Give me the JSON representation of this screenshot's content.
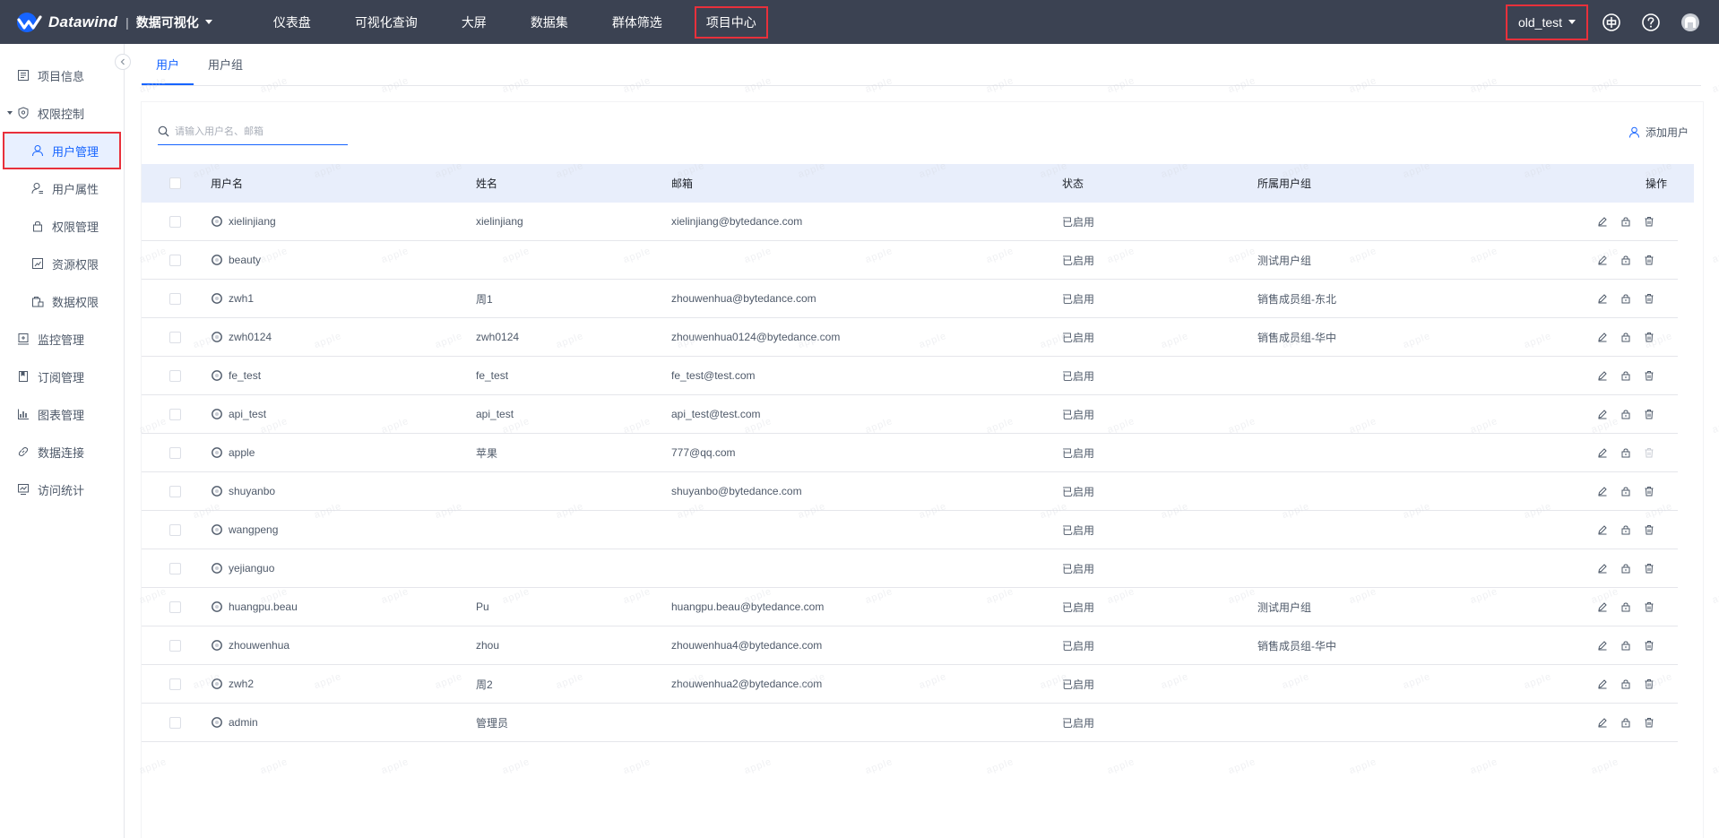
{
  "header": {
    "brand": "Datawind",
    "product": "数据可视化",
    "nav": [
      "仪表盘",
      "可视化查询",
      "大屏",
      "数据集",
      "群体筛选",
      "项目中心"
    ],
    "active_nav": "项目中心",
    "project": "old_test",
    "icons": [
      "plus-circle-icon",
      "help-icon",
      "avatar-icon"
    ]
  },
  "sidebar": {
    "items": [
      {
        "label": "项目信息",
        "icon": "info-icon"
      },
      {
        "label": "权限控制",
        "icon": "shield-icon"
      },
      {
        "label": "用户管理",
        "icon": "user-icon"
      },
      {
        "label": "用户属性",
        "icon": "user-attr-icon"
      },
      {
        "label": "权限管理",
        "icon": "lock-icon"
      },
      {
        "label": "资源权限",
        "icon": "resource-icon"
      },
      {
        "label": "数据权限",
        "icon": "data-lock-icon"
      },
      {
        "label": "监控管理",
        "icon": "monitor-icon"
      },
      {
        "label": "订阅管理",
        "icon": "bookmark-icon"
      },
      {
        "label": "图表管理",
        "icon": "chart-icon"
      },
      {
        "label": "数据连接",
        "icon": "link-icon"
      },
      {
        "label": "访问统计",
        "icon": "stats-icon"
      }
    ]
  },
  "tabs": [
    "用户",
    "用户组"
  ],
  "search": {
    "placeholder": "请输入用户名、邮箱"
  },
  "add_user": "添加用户",
  "table": {
    "columns": [
      "用户名",
      "姓名",
      "邮箱",
      "状态",
      "所属用户组",
      "操作"
    ],
    "rows": [
      {
        "user": "xielinjiang",
        "name": "xielinjiang",
        "email": "xielinjiang@bytedance.com",
        "status": "已启用",
        "group": ""
      },
      {
        "user": "beauty",
        "name": "",
        "email": "",
        "status": "已启用",
        "group": "测试用户组"
      },
      {
        "user": "zwh1",
        "name": "周1",
        "email": "zhouwenhua@bytedance.com",
        "status": "已启用",
        "group": "销售成员组-东北"
      },
      {
        "user": "zwh0124",
        "name": "zwh0124",
        "email": "zhouwenhua0124@bytedance.com",
        "status": "已启用",
        "group": "销售成员组-华中"
      },
      {
        "user": "fe_test",
        "name": "fe_test",
        "email": "fe_test@test.com",
        "status": "已启用",
        "group": ""
      },
      {
        "user": "api_test",
        "name": "api_test",
        "email": "api_test@test.com",
        "status": "已启用",
        "group": ""
      },
      {
        "user": "apple",
        "name": "苹果",
        "email": "777@qq.com",
        "status": "已启用",
        "group": ""
      },
      {
        "user": "shuyanbo",
        "name": "",
        "email": "shuyanbo@bytedance.com",
        "status": "已启用",
        "group": ""
      },
      {
        "user": "wangpeng",
        "name": "",
        "email": "",
        "status": "已启用",
        "group": ""
      },
      {
        "user": "yejianguo",
        "name": "",
        "email": "",
        "status": "已启用",
        "group": ""
      },
      {
        "user": "huangpu.beau",
        "name": "Pu",
        "email": "huangpu.beau@bytedance.com",
        "status": "已启用",
        "group": "测试用户组"
      },
      {
        "user": "zhouwenhua",
        "name": "zhou",
        "email": "zhouwenhua4@bytedance.com",
        "status": "已启用",
        "group": "销售成员组-华中"
      },
      {
        "user": "zwh2",
        "name": "周2",
        "email": "zhouwenhua2@bytedance.com",
        "status": "已启用",
        "group": ""
      },
      {
        "user": "admin",
        "name": "管理员",
        "email": "",
        "status": "已启用",
        "group": ""
      }
    ]
  },
  "watermark": "apple",
  "colors": {
    "topbar": "#3b4252",
    "accent": "#1664ff",
    "highlight": "#e8303b",
    "table_header": "#e8eefb"
  }
}
